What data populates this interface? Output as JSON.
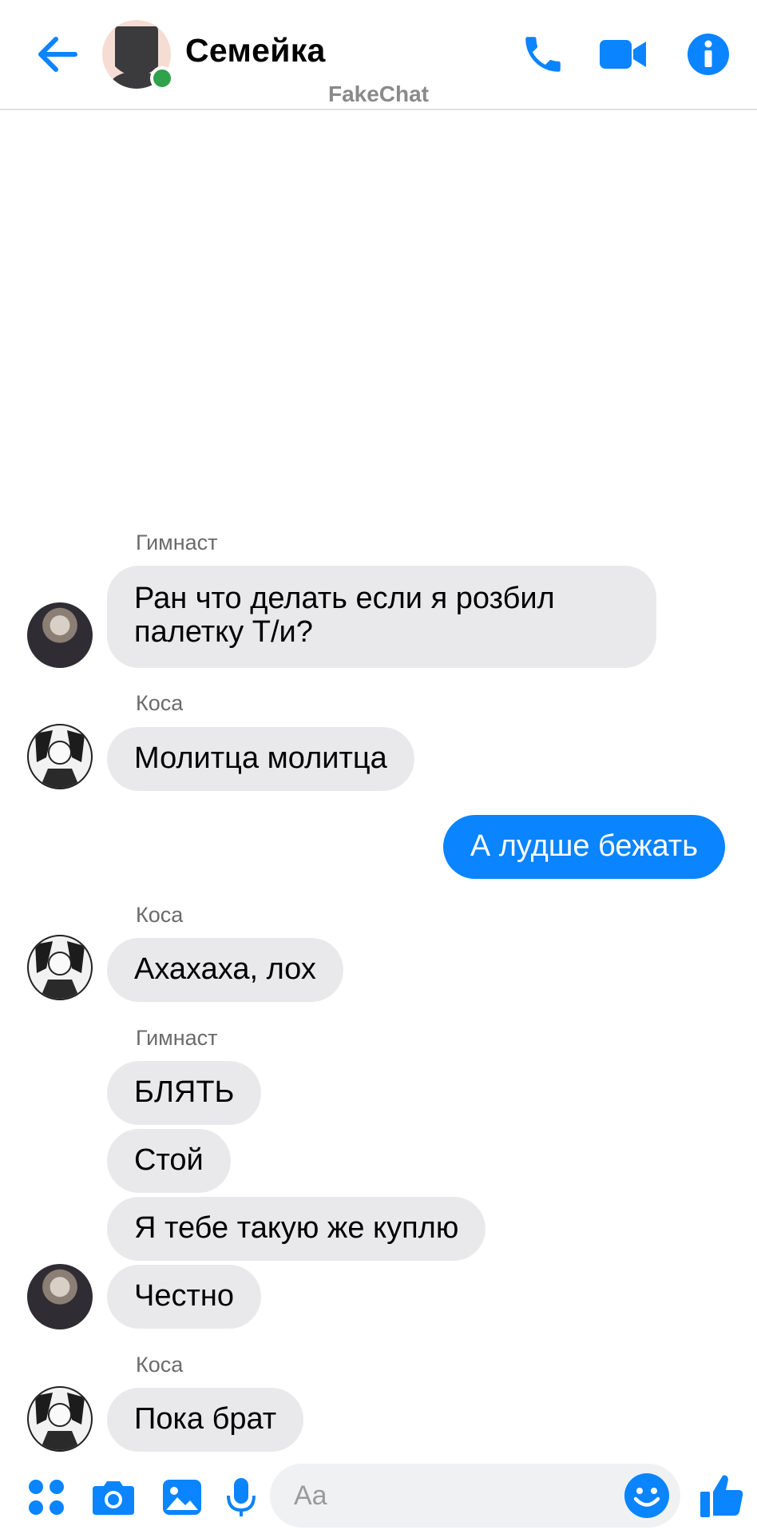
{
  "header": {
    "title": "Семейка",
    "watermark": "FakeChat",
    "icons": {
      "back": "back-arrow-icon",
      "call": "phone-icon",
      "video": "video-camera-icon",
      "info": "info-icon"
    },
    "online": true
  },
  "messages": [
    {
      "sender": "Гимнаст",
      "text": "Ран что делать если я розбил палетку Т/и?",
      "direction": "in"
    },
    {
      "sender": "Коса",
      "text": "Молитца молитца",
      "direction": "in"
    },
    {
      "text": "А лудше бежать",
      "direction": "out"
    },
    {
      "sender": "Коса",
      "text": "Ахахаха, лох",
      "direction": "in"
    },
    {
      "sender": "Гимнаст",
      "text": "БЛЯТЬ",
      "direction": "in"
    },
    {
      "text": "Стой",
      "direction": "in"
    },
    {
      "text": "Я тебе такую же куплю",
      "direction": "in"
    },
    {
      "text": "Честно",
      "direction": "in"
    },
    {
      "sender": "Коса",
      "text": "Пока брат",
      "direction": "in"
    }
  ],
  "composer": {
    "placeholder": "Aa",
    "icons": [
      "apps-icon",
      "camera-icon",
      "image-icon",
      "microphone-icon",
      "emoji-icon",
      "thumbs-up-icon"
    ]
  },
  "colors": {
    "accent": "#0a84ff",
    "incoming_bubble": "#e9e9eb",
    "online": "#31a24c"
  }
}
